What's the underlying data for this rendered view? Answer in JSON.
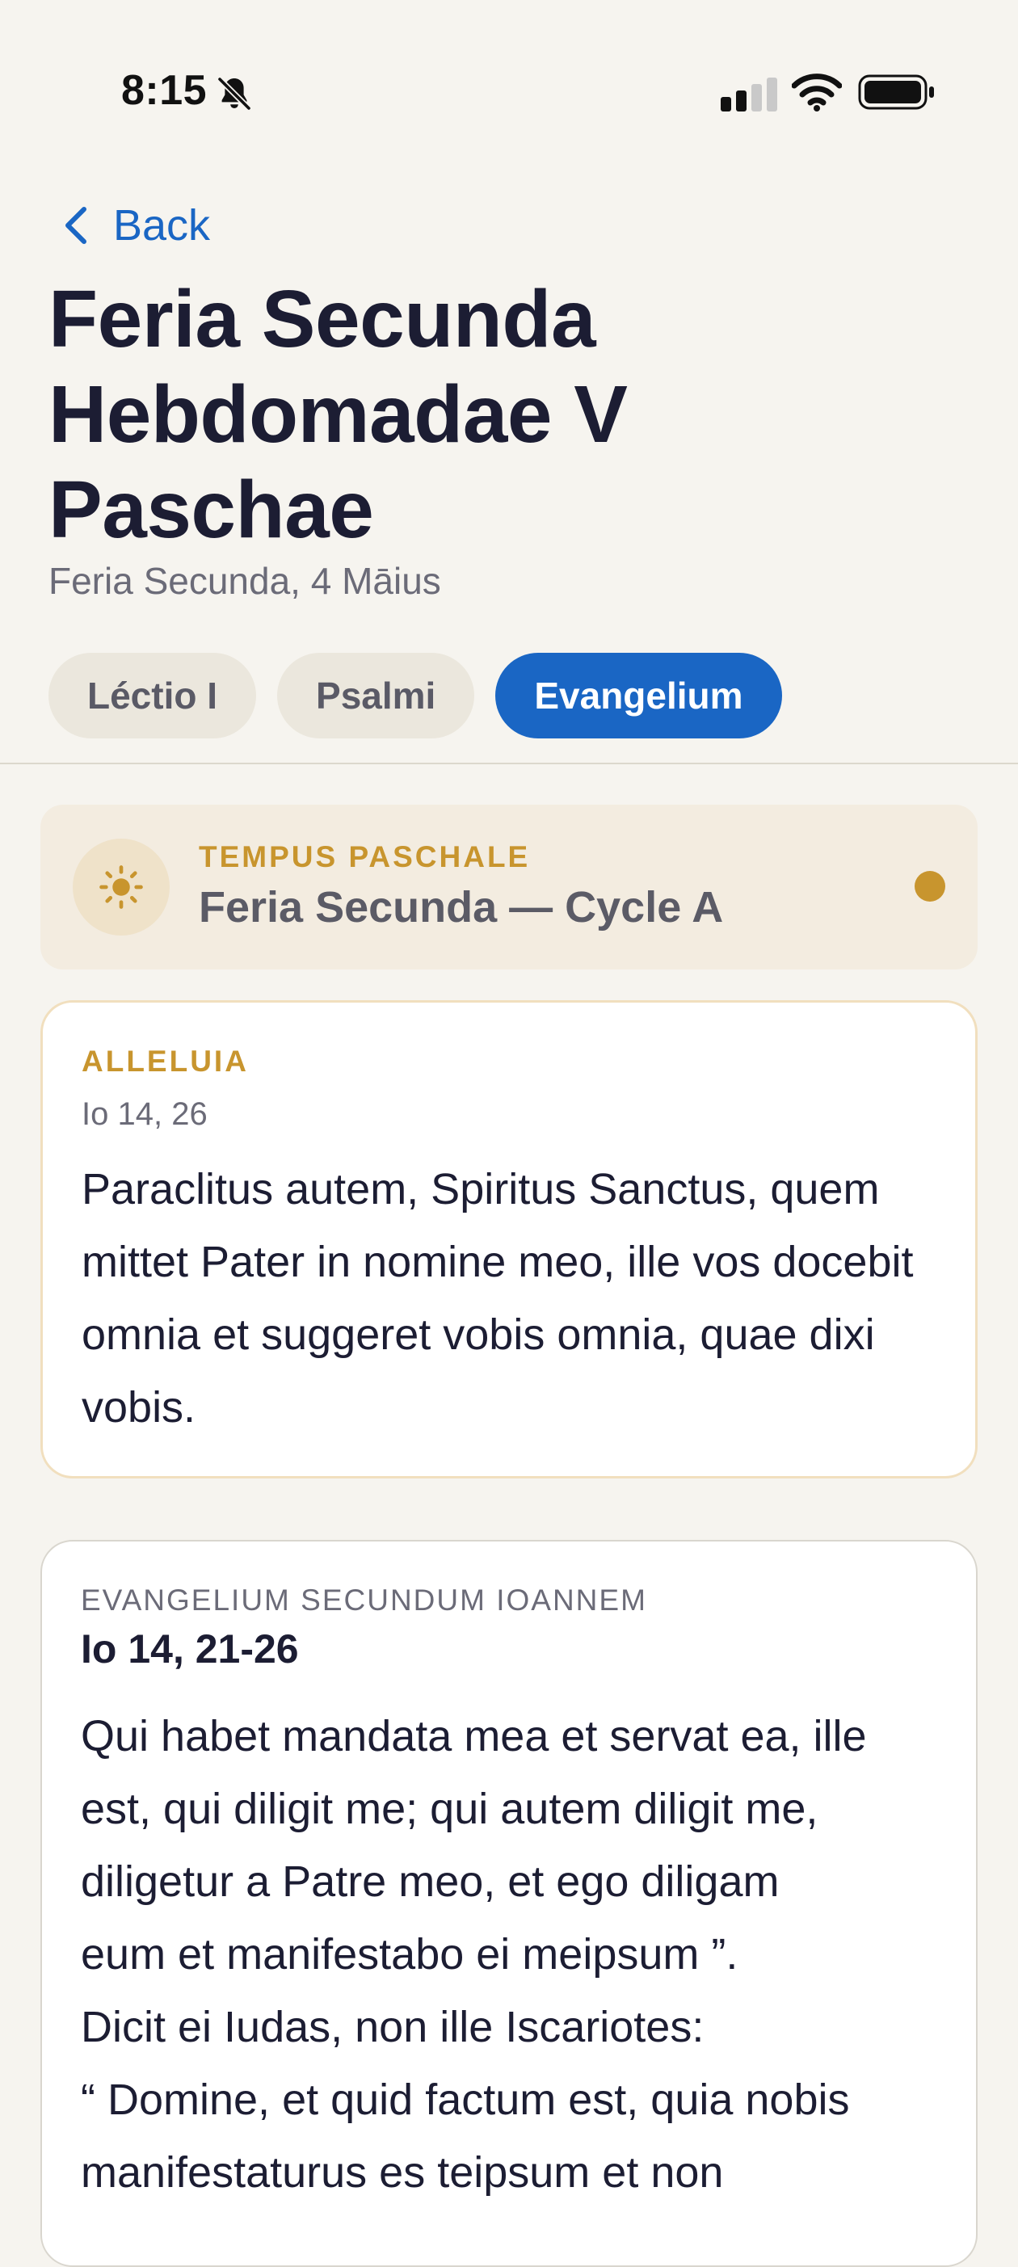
{
  "status_bar": {
    "time": "8:15",
    "icons": [
      "bell-slash-icon",
      "cellular-signal-icon",
      "wifi-icon",
      "battery-icon"
    ]
  },
  "header": {
    "back_label": "Back",
    "title": "Feria Secunda Hebdomadae V Paschae",
    "subtitle": "Feria Secunda, 4 Māius"
  },
  "tabs": [
    {
      "label": "Léctio I",
      "active": false
    },
    {
      "label": "Psalmi",
      "active": false
    },
    {
      "label": "Evangelium",
      "active": true
    }
  ],
  "season": {
    "label": "TEMPUS PASCHALE",
    "title": "Feria Secunda — Cycle A",
    "icon": "sun-icon"
  },
  "alleluia": {
    "label": "ALLELUIA",
    "reference": "Io 14, 26",
    "text": "Paraclitus autem, Spiritus Sanctus, quem mittet Pater in nomine meo, ille vos docebit omnia et suggeret vobis omnia, quae dixi vobis."
  },
  "gospel": {
    "label": "EVANGELIUM SECUNDUM IOANNEM",
    "reference": "Io 14, 21-26",
    "lines": [
      "Qui habet mandata mea et servat ea, ille",
      "est, qui diligit me; qui autem diligit me,",
      "diligetur a Patre meo, et ego diligam",
      "eum et manifestabo ei meipsum ”.",
      "Dicit ei Iudas, non ille Iscariotes:",
      "“ Domine, et quid factum est, quia nobis",
      "manifestaturus es teipsum et non"
    ]
  },
  "colors": {
    "accent_blue": "#1a66c4",
    "season_gold": "#c8952e",
    "background": "#f6f4ef"
  }
}
